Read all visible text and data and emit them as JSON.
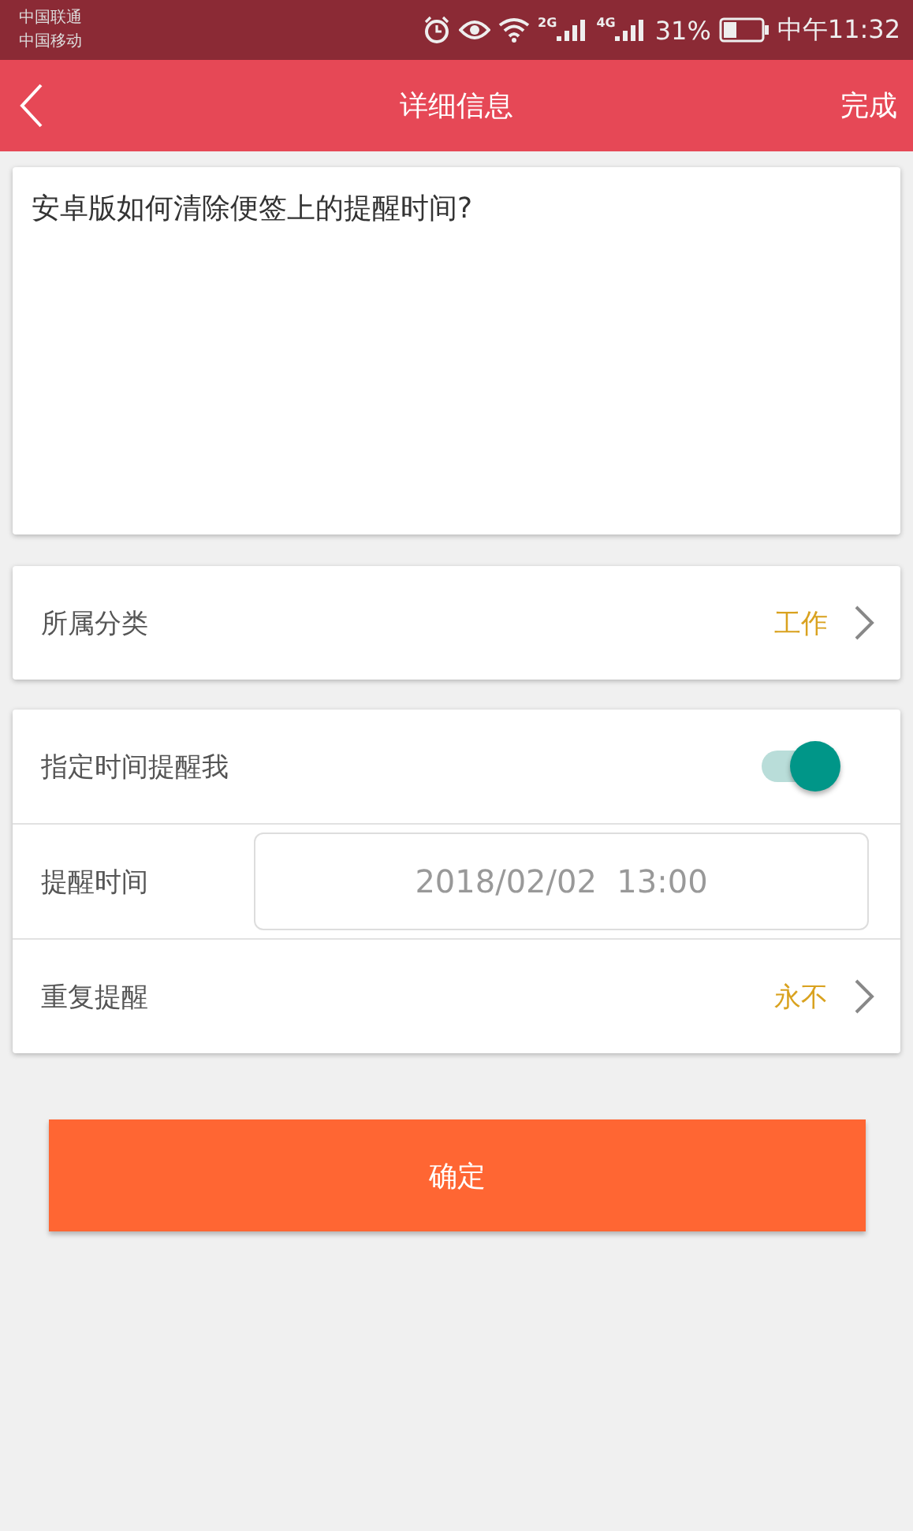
{
  "status_bar": {
    "carriers": [
      "中国联通",
      "中国移动"
    ],
    "network_labels": [
      "2G",
      "4G"
    ],
    "battery": "31%",
    "time": "中午11:32"
  },
  "header": {
    "title": "详细信息",
    "action": "完成"
  },
  "note": {
    "text": "安卓版如何清除便签上的提醒时间?"
  },
  "category": {
    "label": "所属分类",
    "value": "工作"
  },
  "reminder": {
    "toggle": {
      "label": "指定时间提醒我",
      "on": true
    },
    "time": {
      "label": "提醒时间",
      "value": "2018/02/02  13:00"
    },
    "repeat": {
      "label": "重复提醒",
      "value": "永不"
    }
  },
  "confirm": "确定"
}
